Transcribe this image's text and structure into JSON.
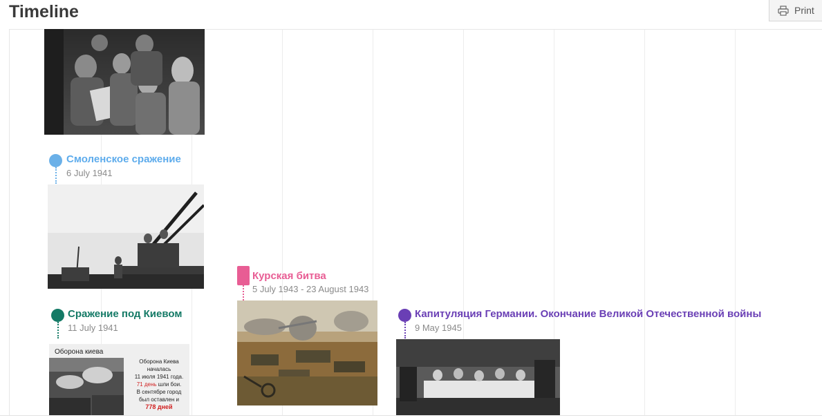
{
  "page": {
    "title": "Timeline"
  },
  "toolbar": {
    "print_label": "Print"
  },
  "events": [
    {
      "title": "Смоленское сражение",
      "date": "6 July 1941",
      "color": "#6ab0e8"
    },
    {
      "title": "Сражение под Киевом",
      "date": "11 July 1941",
      "color": "#147a66"
    },
    {
      "title": "Курская битва",
      "date": "5 July 1943 - 23 August 1943",
      "color": "#e85d94"
    },
    {
      "title": "Капитуляция Германии. Окончание Великой Отечественной войны",
      "date": "9 May 1945",
      "color": "#6a3fb5"
    }
  ],
  "kiev_image": {
    "heading": "Оборона киева",
    "line1": "Оборона  Киева",
    "line2": "началась",
    "line3": "11 июля 1941 года.",
    "line4a": "71 день",
    "line4b": " шли бои.",
    "line5": "В сентябре город",
    "line6": "был оставлен и",
    "line7": "778 дней"
  }
}
